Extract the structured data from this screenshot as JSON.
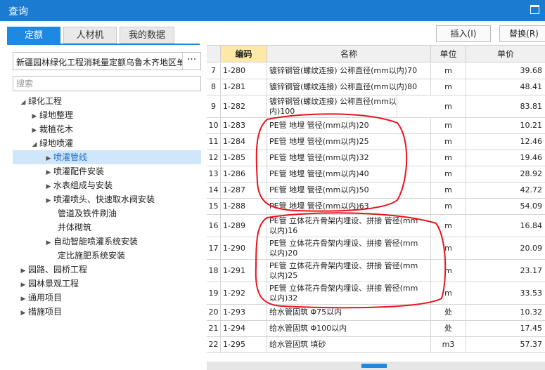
{
  "window": {
    "title": "查询"
  },
  "tabs": [
    {
      "label": "定额"
    },
    {
      "label": "人材机"
    },
    {
      "label": "我的数据"
    }
  ],
  "quota_library": {
    "value": "新疆园林绿化工程消耗量定额乌鲁木齐地区单",
    "more": "···"
  },
  "search": {
    "placeholder": "搜索"
  },
  "tree": [
    {
      "label": "绿化工程"
    },
    {
      "label": "绿地整理"
    },
    {
      "label": "栽植花木"
    },
    {
      "label": "绿地喷灌"
    },
    {
      "label": "喷灌管线"
    },
    {
      "label": "喷灌配件安装"
    },
    {
      "label": "水表组成与安装"
    },
    {
      "label": "喷灌喷头、快速取水阀安装"
    },
    {
      "label": "管道及铁件刷油"
    },
    {
      "label": "井体砌筑"
    },
    {
      "label": "自动智能喷灌系统安装"
    },
    {
      "label": "定比施肥系统安装"
    },
    {
      "label": "园路、园桥工程"
    },
    {
      "label": "园林景观工程"
    },
    {
      "label": "通用项目"
    },
    {
      "label": "措施项目"
    }
  ],
  "toolbar": {
    "insert": "插入(I)",
    "replace": "替换(R)"
  },
  "columns": {
    "code": "编码",
    "name": "名称",
    "unit": "单位",
    "price": "单价"
  },
  "rows": [
    {
      "idx": "7",
      "code": "1-280",
      "name": "镀锌钢管(螺纹连接) 公称直径(mm以内)70",
      "unit": "m",
      "price": "39.68"
    },
    {
      "idx": "8",
      "code": "1-281",
      "name": "镀锌钢管(螺纹连接) 公称直径(mm以内)80",
      "unit": "m",
      "price": "48.41"
    },
    {
      "idx": "9",
      "code": "1-282",
      "name": "镀锌钢管(螺纹连接) 公称直径(mm以内)100",
      "unit": "m",
      "price": "83.81"
    },
    {
      "idx": "10",
      "code": "1-283",
      "name": "PE管 地埋 管径(mm以内)20",
      "unit": "m",
      "price": "10.21"
    },
    {
      "idx": "11",
      "code": "1-284",
      "name": "PE管 地埋 管径(mm以内)25",
      "unit": "m",
      "price": "12.46"
    },
    {
      "idx": "12",
      "code": "1-285",
      "name": "PE管 地埋 管径(mm以内)32",
      "unit": "m",
      "price": "19.46"
    },
    {
      "idx": "13",
      "code": "1-286",
      "name": "PE管 地埋 管径(mm以内)40",
      "unit": "m",
      "price": "28.92"
    },
    {
      "idx": "14",
      "code": "1-287",
      "name": "PE管 地埋 管径(mm以内)50",
      "unit": "m",
      "price": "42.72"
    },
    {
      "idx": "15",
      "code": "1-288",
      "name": "PE管 地埋 管径(mm以内)63",
      "unit": "m",
      "price": "54.09"
    },
    {
      "idx": "16",
      "code": "1-289",
      "name": "PE管 立体花卉骨架内埋设、拼接 管径(mm以内)16",
      "unit": "m",
      "price": "16.84"
    },
    {
      "idx": "17",
      "code": "1-290",
      "name": "PE管 立体花卉骨架内埋设、拼接 管径(mm以内)20",
      "unit": "m",
      "price": "20.09"
    },
    {
      "idx": "18",
      "code": "1-291",
      "name": "PE管 立体花卉骨架内埋设、拼接 管径(mm以内)25",
      "unit": "m",
      "price": "23.17"
    },
    {
      "idx": "19",
      "code": "1-292",
      "name": "PE管 立体花卉骨架内埋设、拼接 管径(mm以内)32",
      "unit": "m",
      "price": "33.53"
    },
    {
      "idx": "20",
      "code": "1-293",
      "name": "给水管固筑 Φ75以内",
      "unit": "处",
      "price": "10.32"
    },
    {
      "idx": "21",
      "code": "1-294",
      "name": "给水管固筑 Φ100以内",
      "unit": "处",
      "price": "17.45"
    },
    {
      "idx": "22",
      "code": "1-295",
      "name": "给水管固筑 填砂",
      "unit": "m3",
      "price": "57.37"
    }
  ]
}
